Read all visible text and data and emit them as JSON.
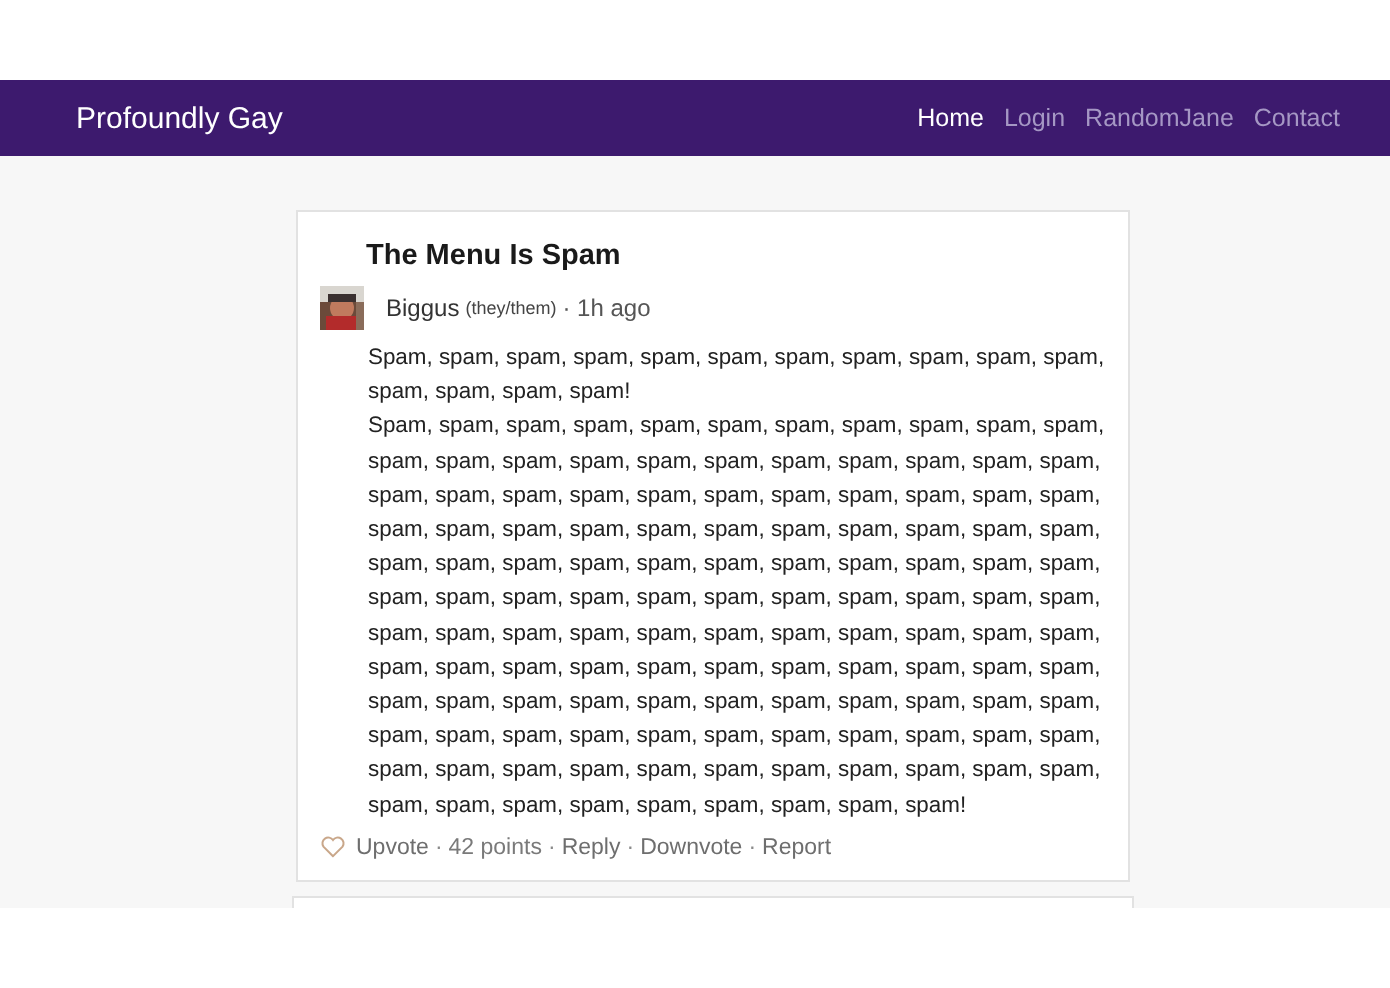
{
  "navbar": {
    "brand": "Profoundly Gay",
    "links": [
      {
        "label": "Home",
        "selected": true
      },
      {
        "label": "Login",
        "selected": false
      },
      {
        "label": "RandomJane",
        "selected": false
      },
      {
        "label": "Contact",
        "selected": false
      }
    ]
  },
  "post": {
    "title": "The Menu Is Spam",
    "author": "Biggus",
    "pronouns": "(they/them)",
    "time": "· 1h ago",
    "paragraphs": [
      "Spam, spam, spam, spam, spam, spam, spam, spam, spam, spam, spam, spam, spam, spam, spam!",
      "Spam, spam, spam, spam, spam, spam, spam, spam, spam, spam, spam, spam, spam, spam, spam, spam, spam, spam, spam, spam, spam, spam, spam, spam, spam, spam, spam, spam, spam, spam, spam, spam, spam, spam, spam, spam, spam, spam, spam, spam, spam, spam, spam, spam, spam, spam, spam, spam, spam, spam, spam, spam, spam, spam, spam, spam, spam, spam, spam, spam, spam, spam, spam, spam, spam, spam, spam, spam, spam, spam, spam, spam, spam, spam, spam, spam, spam, spam, spam, spam, spam, spam, spam, spam, spam, spam, spam, spam, spam, spam, spam, spam, spam, spam, spam, spam, spam, spam, spam, spam, spam, spam, spam, spam, spam, spam, spam, spam, spam, spam, spam, spam, spam, spam, spam, spam, spam, spam, spam, spam, spam, spam, spam, spam, spam, spam, spam, spam, spam, spam!"
    ],
    "actions": [
      {
        "kind": "link",
        "label": "Upvote"
      },
      {
        "kind": "separator",
        "label": "·"
      },
      {
        "kind": "count",
        "label": "42 points"
      },
      {
        "kind": "separator",
        "label": "·"
      },
      {
        "kind": "link",
        "label": "Reply"
      },
      {
        "kind": "separator",
        "label": "·"
      },
      {
        "kind": "link",
        "label": "Downvote"
      },
      {
        "kind": "separator",
        "label": "·"
      },
      {
        "kind": "link",
        "label": "Report"
      }
    ]
  }
}
